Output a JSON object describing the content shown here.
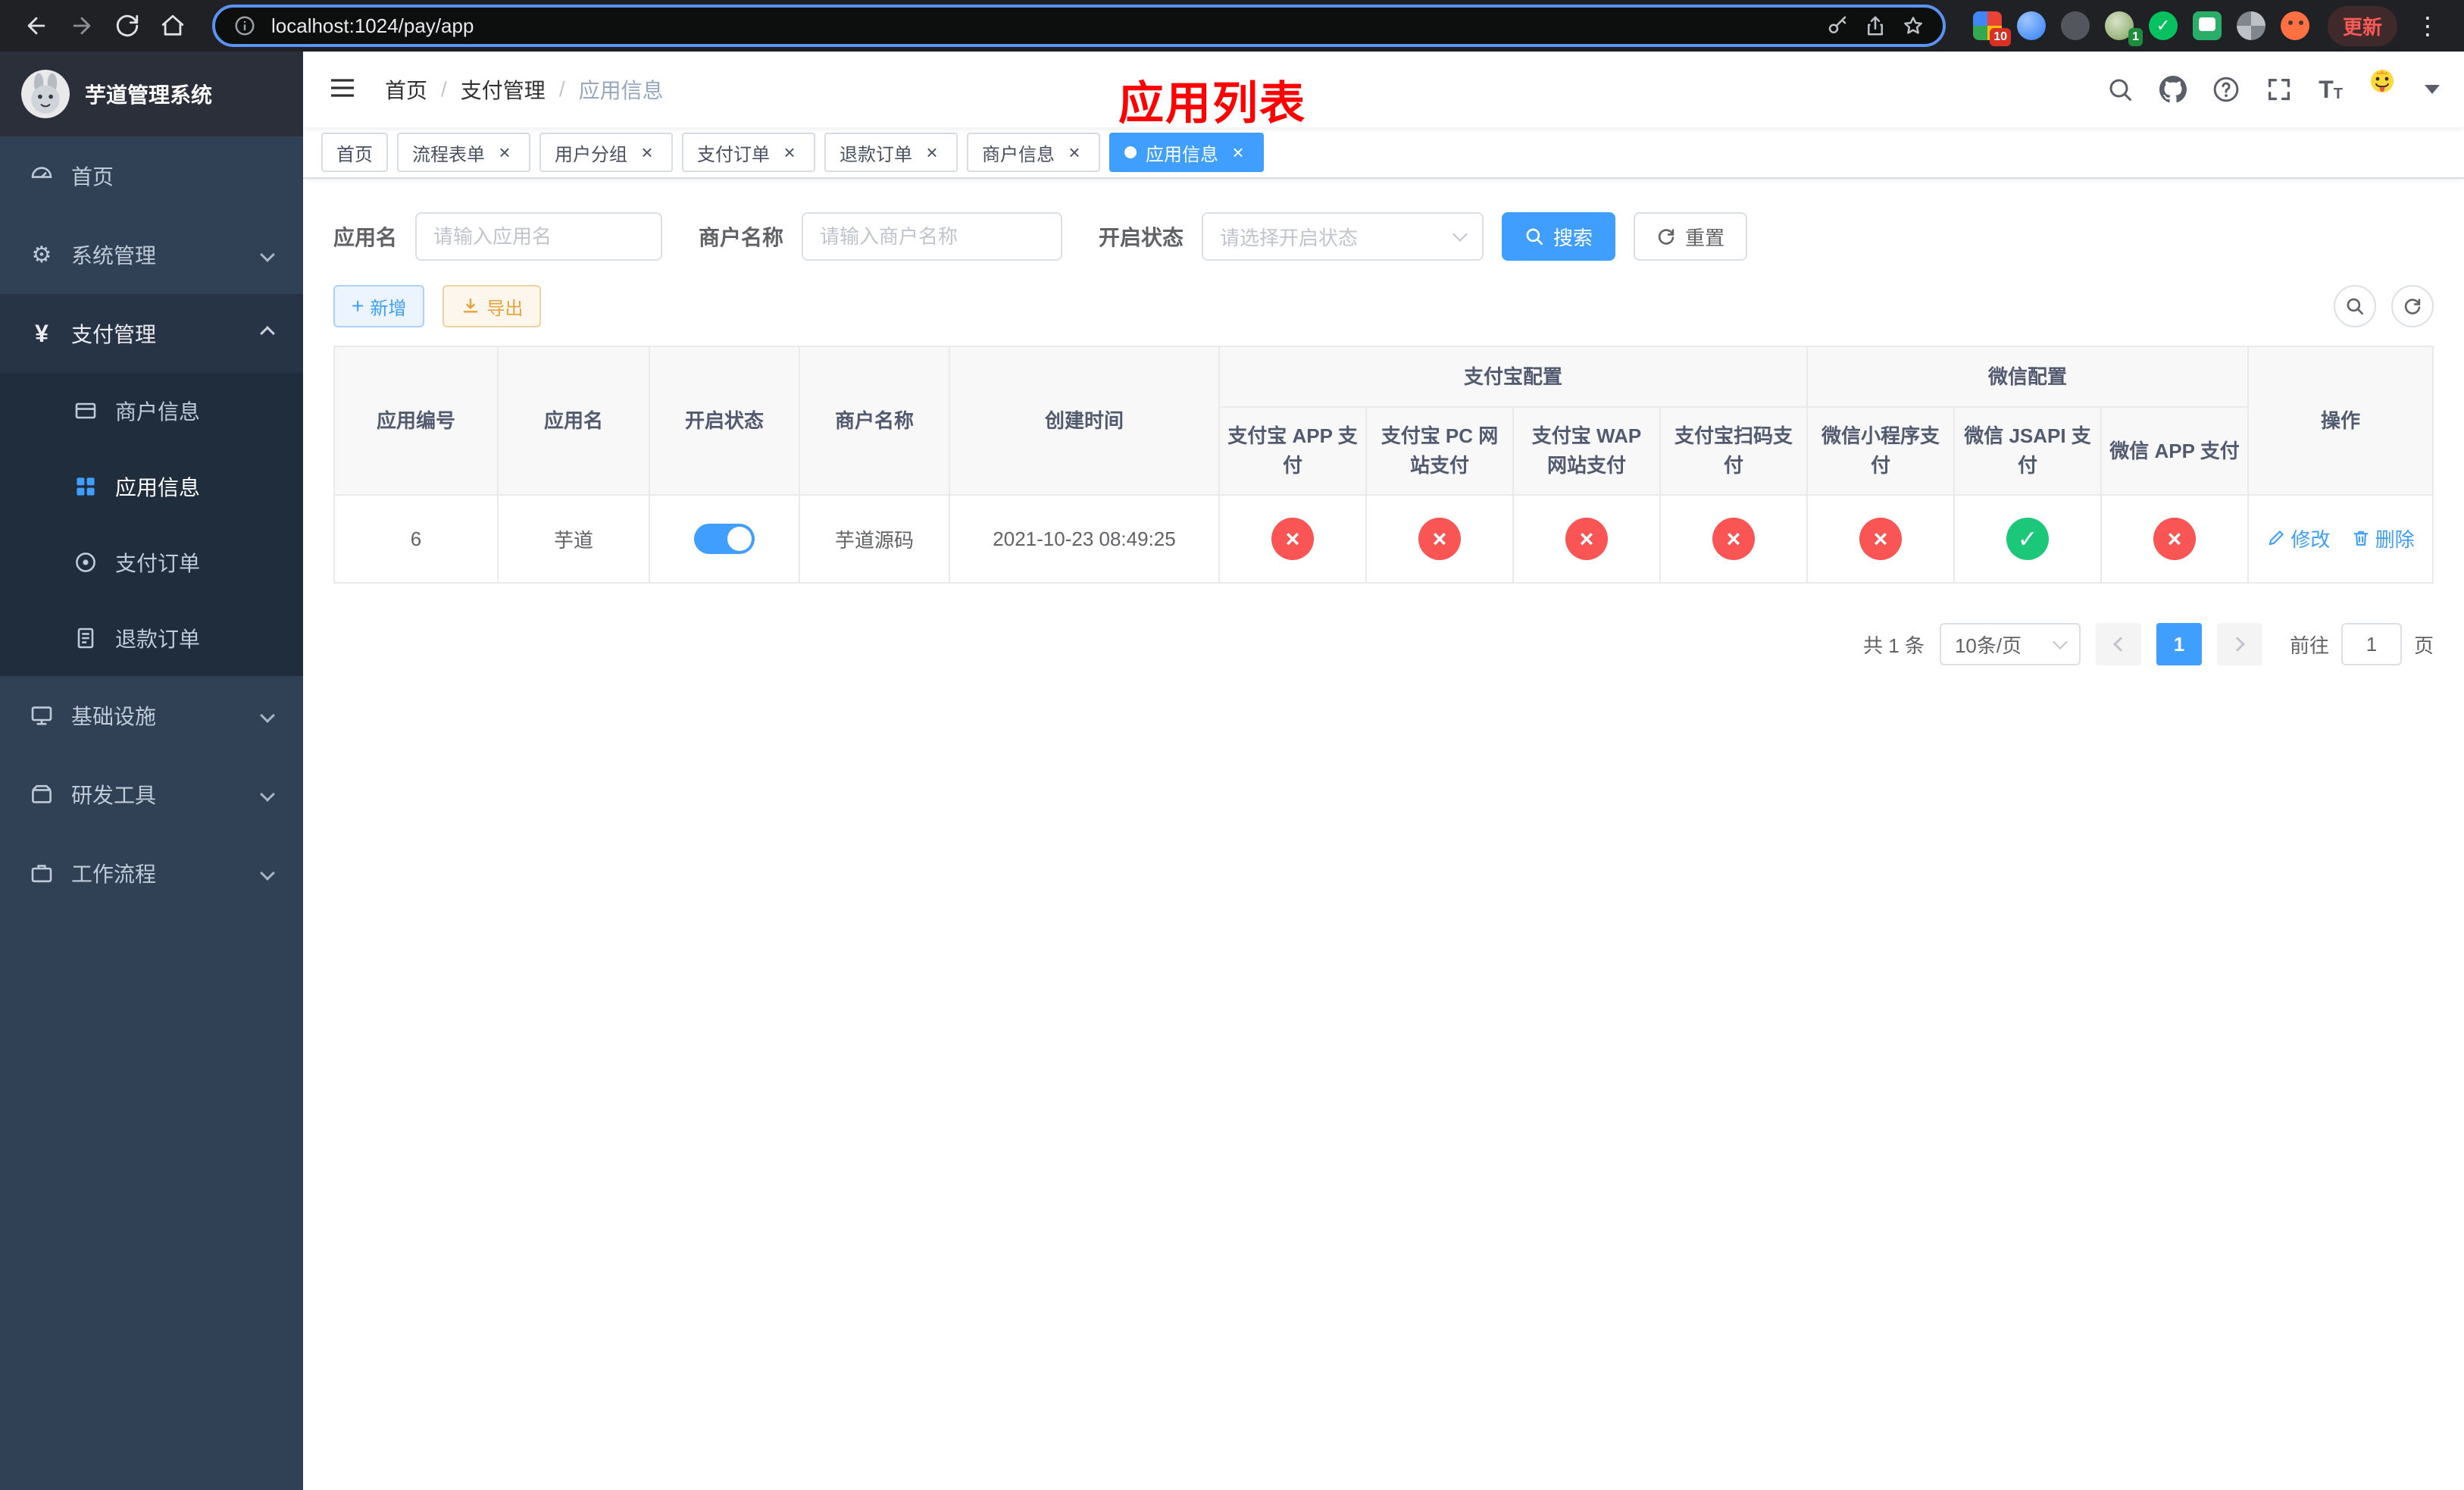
{
  "browser": {
    "url": "localhost:1024/pay/app",
    "update_label": "更新",
    "badge_first": "10",
    "badge_profile": "1"
  },
  "icons": {
    "gear": "⚙",
    "yen": "¥",
    "close": "×",
    "kebab": "⋮",
    "plus": "+",
    "check": "✓",
    "cross": "×",
    "font": "T"
  },
  "colors": {
    "primary": "#409eff",
    "success": "#1dc779",
    "danger": "#fa5555",
    "warning": "#e6a23c",
    "annotation_red": "#fe0100"
  },
  "sidebar": {
    "title": "芋道管理系统",
    "home": "首页",
    "system": "系统管理",
    "pay": "支付管理",
    "merchant": "商户信息",
    "app": "应用信息",
    "order": "支付订单",
    "refund": "退款订单",
    "infra": "基础设施",
    "dev": "研发工具",
    "workflow": "工作流程"
  },
  "header": {
    "crumb_home": "首页",
    "crumb_section": "支付管理",
    "crumb_current": "应用信息",
    "overlay_title": "应用列表"
  },
  "tabs": [
    {
      "label": "首页"
    },
    {
      "label": "流程表单"
    },
    {
      "label": "用户分组"
    },
    {
      "label": "支付订单"
    },
    {
      "label": "退款订单"
    },
    {
      "label": "商户信息"
    },
    {
      "label": "应用信息"
    }
  ],
  "filters": {
    "app_name_label": "应用名",
    "app_name_placeholder": "请输入应用名",
    "merchant_label": "商户名称",
    "merchant_placeholder": "请输入商户名称",
    "status_label": "开启状态",
    "status_placeholder": "请选择开启状态",
    "search_label": "搜索",
    "reset_label": "重置"
  },
  "toolbar": {
    "add_label": "新增",
    "export_label": "导出"
  },
  "table": {
    "groups": {
      "alipay": "支付宝配置",
      "wechat": "微信配置"
    },
    "columns": {
      "id": "应用编号",
      "name": "应用名",
      "status": "开启状态",
      "merchant": "商户名称",
      "created": "创建时间",
      "alipay_app": "支付宝 APP 支付",
      "alipay_pc": "支付宝 PC 网站支付",
      "alipay_wap": "支付宝 WAP 网站支付",
      "alipay_qr": "支付宝扫码支付",
      "wx_lite": "微信小程序支付",
      "wx_jsapi": "微信 JSAPI 支付",
      "wx_app": "微信 APP 支付",
      "actions": "操作"
    },
    "row": {
      "id": "6",
      "name": "芋道",
      "enabled": true,
      "merchant": "芋道源码",
      "created": "2021-10-23 08:49:25",
      "channels": {
        "alipay_app": false,
        "alipay_pc": false,
        "alipay_wap": false,
        "alipay_qr": false,
        "wx_lite": false,
        "wx_jsapi": true,
        "wx_app": false
      },
      "edit_label": "修改",
      "delete_label": "删除"
    }
  },
  "pagination": {
    "total_text": "共 1 条",
    "page_size_text": "10条/页",
    "current_page": "1",
    "jump_prefix": "前往",
    "jump_value": "1",
    "jump_suffix": "页"
  }
}
